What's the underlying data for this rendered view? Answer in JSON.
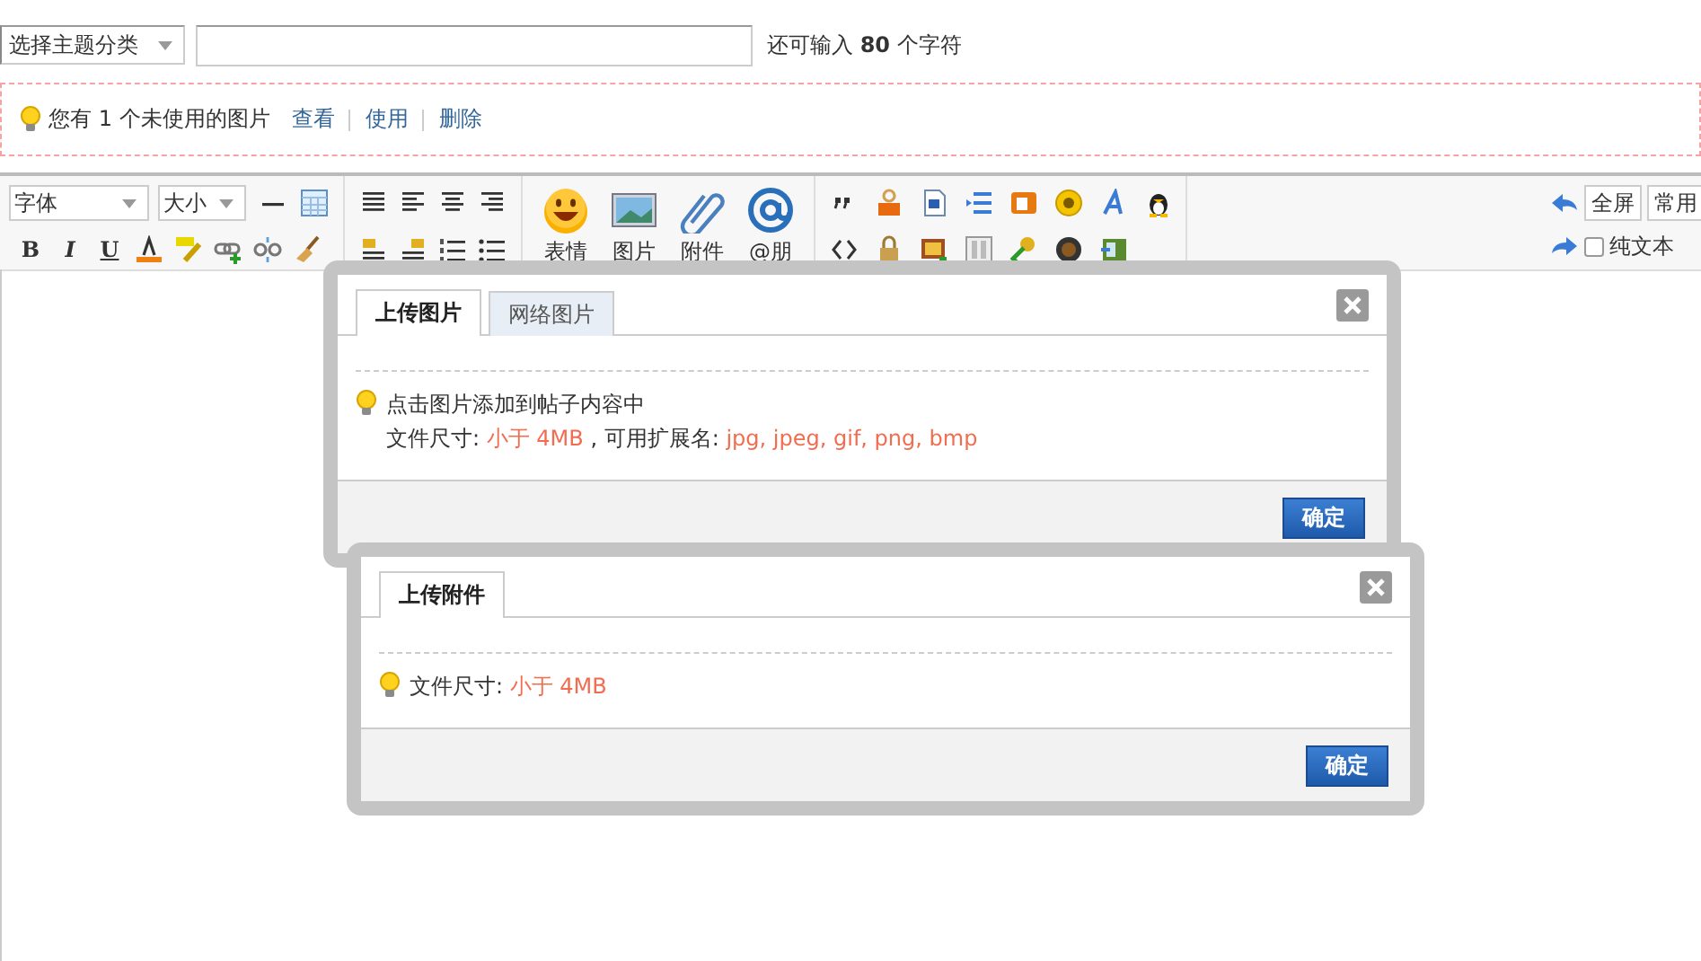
{
  "topic_select": {
    "value": "选择主题分类"
  },
  "char_counter": "还可输入 **80** 个字符",
  "notice": {
    "text": "您有 1 个未使用的图片",
    "links": [
      "查看",
      "使用",
      "删除"
    ]
  },
  "toolbar": {
    "font_select": "字体",
    "size_select": "大小",
    "format_buttons": [
      {
        "label": "B",
        "kind": "bold"
      },
      {
        "label": "I",
        "kind": "italic"
      },
      {
        "label": "U",
        "kind": "underline"
      }
    ],
    "big_buttons": [
      {
        "kind": "smiley",
        "label": "表情"
      },
      {
        "kind": "image",
        "label": "图片"
      },
      {
        "kind": "clip",
        "label": "附件"
      },
      {
        "kind": "at",
        "label": "@朋"
      }
    ],
    "fullscreen": "全屏",
    "common": "常用",
    "plain_text": {
      "label": "纯文本",
      "checked": false
    }
  },
  "dialogs": [
    {
      "tabs": [
        {
          "label": "上传图片",
          "selected": true
        },
        {
          "label": "网络图片",
          "selected": false
        }
      ],
      "tips": [
        [
          {
            "text": "点击图片添加到帖子内容中",
            "highlight": false
          }
        ],
        [
          {
            "text": "文件尺寸: ",
            "highlight": false
          },
          {
            "text": "小于 4MB",
            "highlight": true
          },
          {
            "text": " , 可用扩展名: ",
            "highlight": false
          },
          {
            "text": "jpg, jpeg, gif, png, bmp",
            "highlight": true
          }
        ]
      ],
      "button": "确定"
    },
    {
      "tabs": [
        {
          "label": "上传附件",
          "selected": true
        }
      ],
      "tips": [
        [
          {
            "text": "文件尺寸: ",
            "highlight": false
          },
          {
            "text": "小于 4MB",
            "highlight": true
          }
        ]
      ],
      "button": "确定"
    }
  ]
}
